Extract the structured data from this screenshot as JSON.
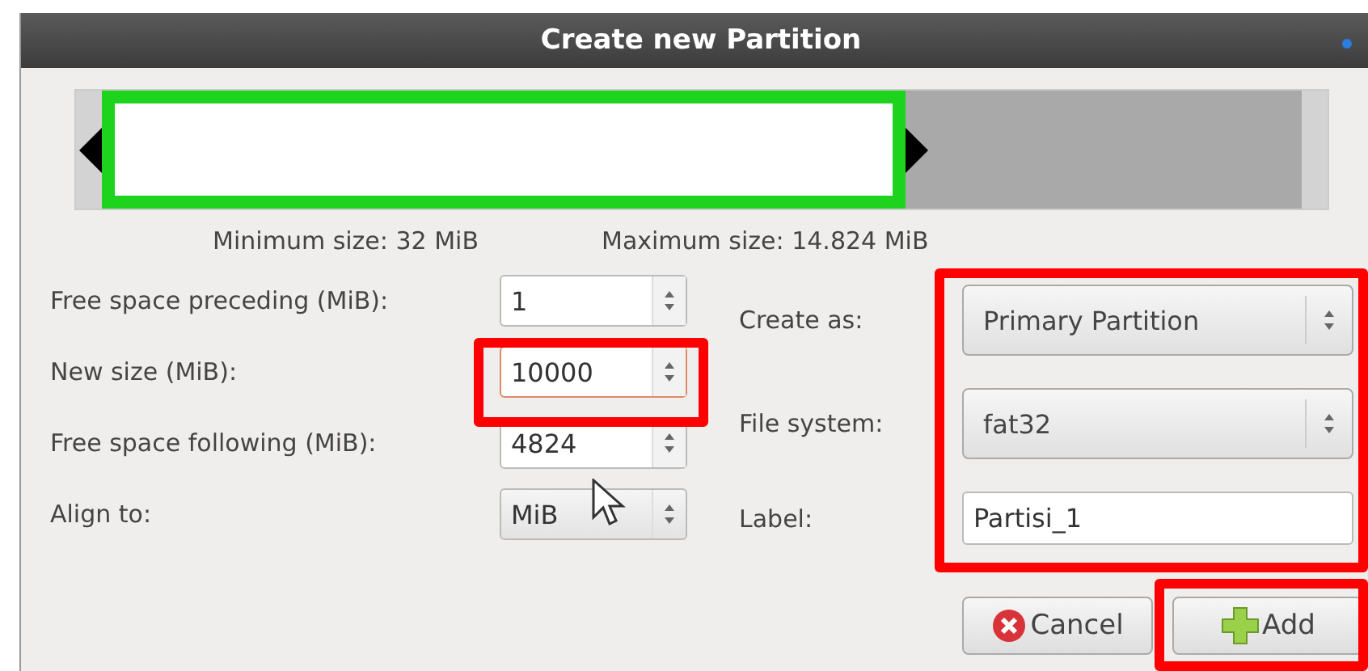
{
  "window": {
    "title": "Create new Partition"
  },
  "partition_bar": {
    "level": 0.67
  },
  "min_size": "Minimum size: 32 MiB",
  "max_size": "Maximum size: 14.824 MiB",
  "left_fields": [
    {
      "label": "Free space preceding (MiB):",
      "value": "1",
      "kind": "spin",
      "focused": false
    },
    {
      "label": "New size (MiB):",
      "value": "10000",
      "kind": "spin",
      "focused": true
    },
    {
      "label": "Free space following (MiB):",
      "value": "4824",
      "kind": "spin",
      "focused": false
    },
    {
      "label": "Align to:",
      "value": "MiB",
      "kind": "combo",
      "focused": false
    }
  ],
  "right_fields": [
    {
      "label": "Create as:",
      "value": "Primary Partition",
      "kind": "combo"
    },
    {
      "label": "File system:",
      "value": "fat32",
      "kind": "combo"
    },
    {
      "label": "Label:",
      "value": "Partisi_1",
      "kind": "text"
    }
  ],
  "buttons": [
    {
      "label": "Cancel",
      "kind": "cancel"
    },
    {
      "label": "Add",
      "kind": "add"
    }
  ]
}
